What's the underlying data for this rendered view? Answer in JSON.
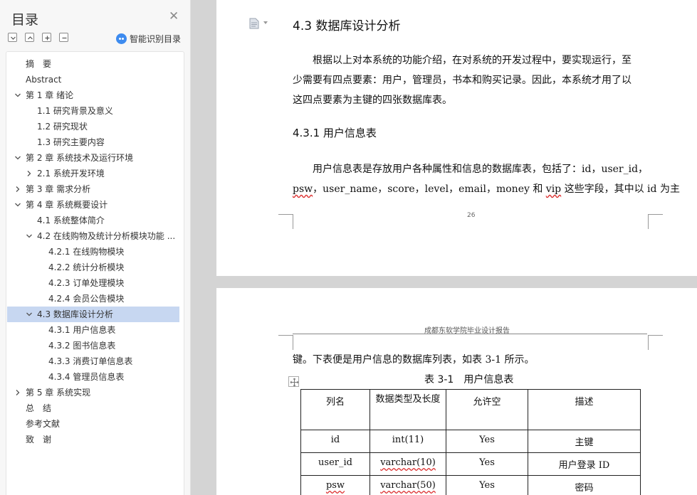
{
  "toc": {
    "title": "目录",
    "ai_label": "智能识别目录",
    "items": [
      {
        "label": "摘　要",
        "level": 0,
        "chevron": "none"
      },
      {
        "label": "Abstract",
        "level": 0,
        "chevron": "none"
      },
      {
        "label": "第 1 章  绪论",
        "level": 0,
        "chevron": "down"
      },
      {
        "label": "1.1  研究背景及意义",
        "level": 1,
        "chevron": "none"
      },
      {
        "label": "1.2  研究现状",
        "level": 1,
        "chevron": "none"
      },
      {
        "label": "1.3  研究主要内容",
        "level": 1,
        "chevron": "none"
      },
      {
        "label": "第 2 章  系统技术及运行环境",
        "level": 0,
        "chevron": "down"
      },
      {
        "label": "2.1 系统开发环境",
        "level": 1,
        "chevron": "right"
      },
      {
        "label": "第 3 章  需求分析",
        "level": 0,
        "chevron": "right"
      },
      {
        "label": "第 4 章  系统概要设计",
        "level": 0,
        "chevron": "down"
      },
      {
        "label": "4.1 系统整体简介",
        "level": 1,
        "chevron": "none"
      },
      {
        "label": "4.2 在线购物及统计分析模块功能 ...",
        "level": 1,
        "chevron": "down"
      },
      {
        "label": "4.2.1 在线购物模块",
        "level": 2,
        "chevron": "none"
      },
      {
        "label": "4.2.2 统计分析模块",
        "level": 2,
        "chevron": "none"
      },
      {
        "label": "4.2.3 订单处理模块",
        "level": 2,
        "chevron": "none"
      },
      {
        "label": "4.2.4 会员公告模块",
        "level": 2,
        "chevron": "none"
      },
      {
        "label": "4.3 数据库设计分析",
        "level": 1,
        "chevron": "down",
        "active": true
      },
      {
        "label": "4.3.1 用户信息表",
        "level": 2,
        "chevron": "none"
      },
      {
        "label": "4.3.2 图书信息表",
        "level": 2,
        "chevron": "none"
      },
      {
        "label": "4.3.3 消费订单信息表",
        "level": 2,
        "chevron": "none"
      },
      {
        "label": "4.3.4 管理员信息表",
        "level": 2,
        "chevron": "none"
      },
      {
        "label": "第 5 章  系统实现",
        "level": 0,
        "chevron": "right"
      },
      {
        "label": "总　结",
        "level": 0,
        "chevron": "none"
      },
      {
        "label": "参考文献",
        "level": 0,
        "chevron": "none"
      },
      {
        "label": "致　谢",
        "level": 0,
        "chevron": "none"
      }
    ]
  },
  "page1": {
    "heading": "4.3 数据库设计分析",
    "para1_lines": [
      "根据以上对本系统的功能介绍，在对系统的开发过程中，要实现运行，至",
      "少需要有四点要素：用户，管理员，书本和购买记录。因此，本系统才用了以",
      "这四点要素为主键的四张数据库表。"
    ],
    "subheading": "4.3.1 用户信息表",
    "para2_line1": "用户信息表是存放用户各种属性和信息的数据库表，包括了：id，user_id，",
    "para2_line2": {
      "psw": "psw",
      "mid": "，user_name，score，level，email，money 和 ",
      "vip": "vip",
      "tail": " 这些字段，其中以 id 为主"
    },
    "page_number": "26"
  },
  "page2": {
    "header": "成都东软学院毕业设计报告",
    "continuation": "键。下表便是用户信息的数据库列表，如表 3-1 所示。",
    "caption": "表 3-1　用户信息表",
    "table": {
      "headers": [
        "列名",
        "数据类型及长度",
        "允许空",
        "描述"
      ],
      "rows": [
        {
          "name": "id",
          "type": "int(11)",
          "nullable": "Yes",
          "desc": "主键"
        },
        {
          "name": "user_id",
          "type": "varchar(10)",
          "nullable": "Yes",
          "desc": "用户登录 ID"
        },
        {
          "name": "psw",
          "type": "varchar(50)",
          "nullable": "Yes",
          "desc": "密码"
        }
      ]
    }
  },
  "colors": {
    "active_toc": "#c7d7f1",
    "accent": "#3d8bef",
    "spell_underline": "#d33"
  }
}
